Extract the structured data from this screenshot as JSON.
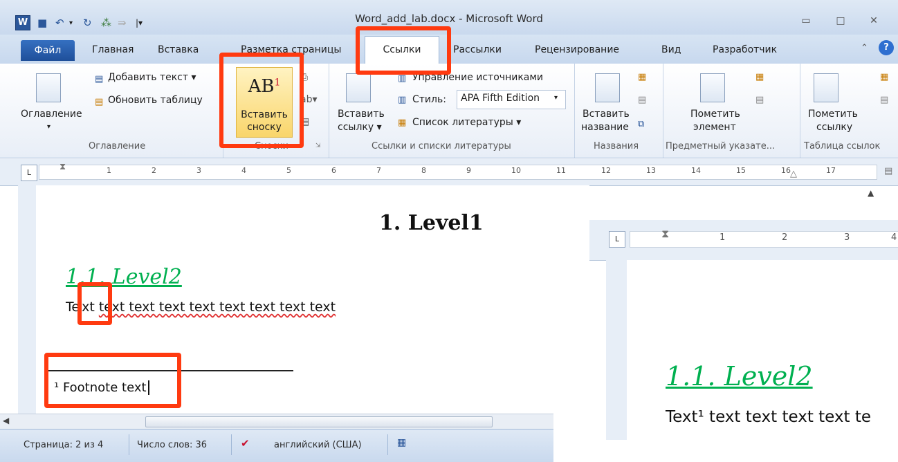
{
  "window": {
    "title": "Word_add_lab.docx - Microsoft Word",
    "app_icon_letter": "W"
  },
  "tabs": [
    "Файл",
    "Главная",
    "Вставка",
    "Разметка страницы",
    "Ссылки",
    "Рассылки",
    "Рецензирование",
    "Вид",
    "Разработчик"
  ],
  "ribbon": {
    "toc": {
      "big_label": "Оглавление",
      "add_text": "Добавить текст ▾",
      "update_table": "Обновить таблицу",
      "group": "Оглавление"
    },
    "footnotes": {
      "insert_label_1": "Вставить",
      "insert_label_2": "сноску",
      "group": "Сноски"
    },
    "citations": {
      "insert_label_1": "Вставить",
      "insert_label_2": "ссылку ▾",
      "manage_sources": "Управление источниками",
      "style_label": "Стиль:",
      "style_value": "APA Fifth Edition",
      "bibliography": "Список литературы ▾",
      "group": "Ссылки и списки литературы"
    },
    "captions": {
      "insert_label_1": "Вставить",
      "insert_label_2": "название",
      "group": "Названия"
    },
    "index": {
      "mark_label_1": "Пометить",
      "mark_label_2": "элемент",
      "group": "Предметный указате..."
    },
    "toa": {
      "mark_label_1": "Пометить",
      "mark_label_2": "ссылку",
      "group": "Таблица ссылок"
    }
  },
  "ruler": {
    "numbers": [
      "1",
      "2",
      "3",
      "4",
      "5",
      "6",
      "7",
      "8",
      "9",
      "10",
      "11",
      "12",
      "13",
      "14",
      "15",
      "16",
      "17"
    ],
    "tab_selector": "L"
  },
  "document": {
    "heading1": "1. Level1",
    "heading2": "1.1. Level2",
    "body_first": "Text",
    "body_rest": "text text text text text text text text",
    "body_prefix": "Te",
    "body_mid": "xt",
    "footnote": "¹ Footnote text"
  },
  "inset": {
    "heading2": "1.1. Level2",
    "body": "Text¹ text text text text te",
    "ruler_numbers": [
      "1",
      "2",
      "3",
      "4"
    ]
  },
  "status": {
    "page": "Страница: 2 из 4",
    "words": "Число слов: 36",
    "language": "английский (США)"
  },
  "colors": {
    "highlight": "#ff3a10",
    "heading2": "#00b050",
    "spell_error": "#e03030"
  }
}
